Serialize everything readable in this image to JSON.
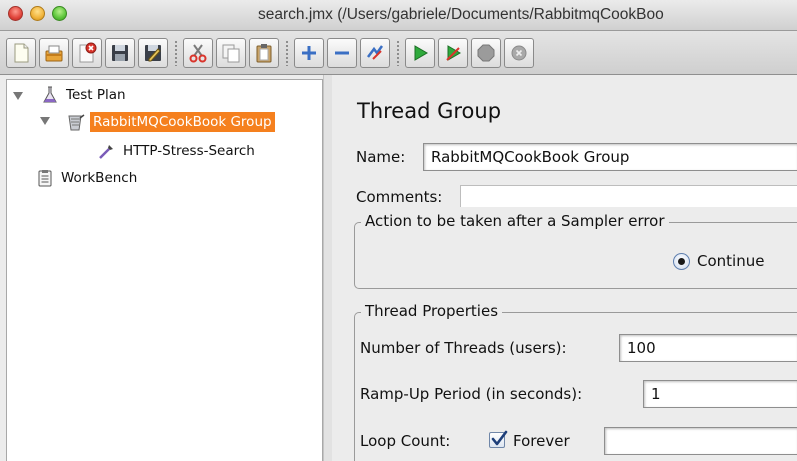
{
  "window": {
    "title": "search.jmx (/Users/gabriele/Documents/RabbitmqCookBoo"
  },
  "toolbar": {
    "icons": [
      "new-icon",
      "templates-icon",
      "open-icon",
      "close-icon",
      "save-icon",
      "save-as-icon",
      "cut-icon",
      "copy-icon",
      "paste-icon",
      "expand-icon",
      "collapse-icon",
      "toggle-icon",
      "start-icon",
      "start-no-pauses-icon",
      "stop-icon",
      "shutdown-icon"
    ]
  },
  "tree": {
    "items": [
      {
        "label": "Test Plan",
        "icon": "flask-icon",
        "level": 0,
        "expanded": true
      },
      {
        "label": "RabbitMQCookBook Group",
        "icon": "thread-group-icon",
        "level": 1,
        "expanded": true,
        "selected": true
      },
      {
        "label": "HTTP-Stress-Search",
        "icon": "pipette-icon",
        "level": 2
      },
      {
        "label": "WorkBench",
        "icon": "clipboard-icon",
        "level": 0
      }
    ]
  },
  "editor": {
    "title": "Thread Group",
    "name_label": "Name:",
    "name_value": "RabbitMQCookBook Group",
    "comments_label": "Comments:",
    "sampler_error": {
      "legend": "Action to be taken after a Sampler error",
      "selected_option": "Continue"
    },
    "thread_properties": {
      "legend": "Thread Properties",
      "threads_label": "Number of Threads (users):",
      "threads_value": "100",
      "rampup_label": "Ramp-Up Period (in seconds):",
      "rampup_value": "1",
      "loop_label": "Loop Count:",
      "forever_label": "Forever",
      "forever_checked": true,
      "loop_value": ""
    }
  },
  "colors": {
    "selection": "#f5801e",
    "panel": "#ececec"
  }
}
